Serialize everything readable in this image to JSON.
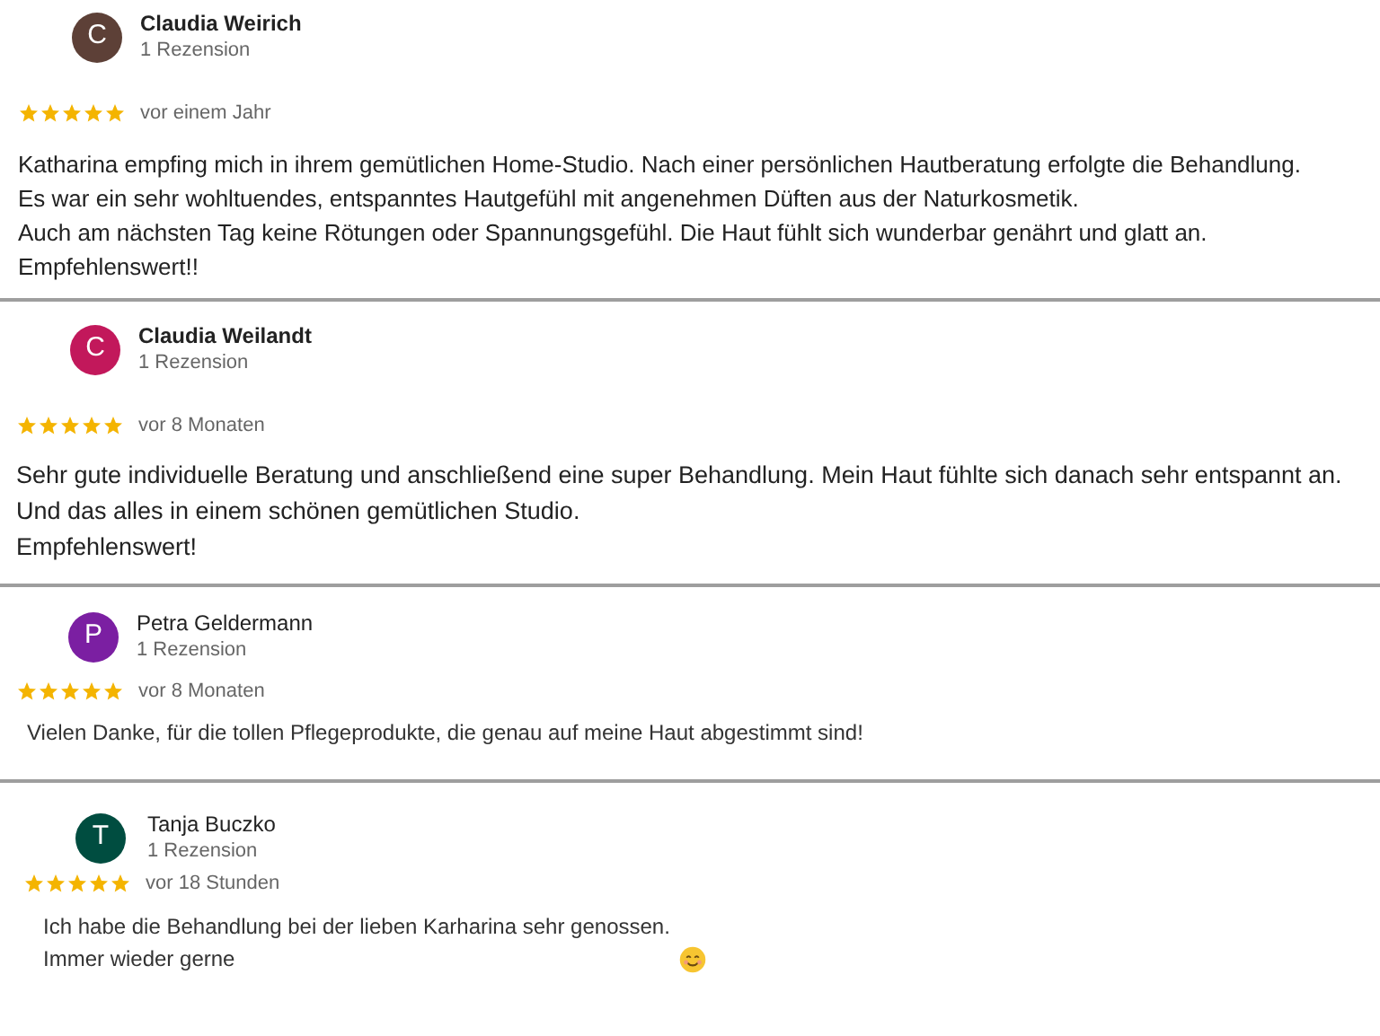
{
  "reviews": [
    {
      "initial": "C",
      "color": "#5d4037",
      "name": "Claudia Weirich",
      "count": "1 Rezension",
      "stars": 5,
      "time": "vor einem Jahr",
      "text": "Katharina empfing mich in ihrem gemütlichen Home-Studio. Nach einer persönlichen Hautberatung erfolgte die Behandlung.\nEs war ein sehr wohltuendes, entspanntes Hautgefühl mit angenehmen Düften aus der Naturkosmetik.\nAuch am nächsten Tag keine Rötungen oder Spannungsgefühl. Die Haut fühlt sich wunderbar genährt und glatt an.\nEmpfehlenswert!!",
      "emoji": false
    },
    {
      "initial": "C",
      "color": "#c2185b",
      "name": "Claudia Weilandt",
      "count": "1 Rezension",
      "stars": 5,
      "time": "vor 8 Monaten",
      "text": "Sehr gute individuelle Beratung und anschließend eine super Behandlung. Mein Haut fühlte sich danach sehr entspannt an.\nUnd das alles in einem schönen gemütlichen Studio.\nEmpfehlenswert!",
      "emoji": false
    },
    {
      "initial": "P",
      "color": "#7b1fa2",
      "name": "Petra Geldermann",
      "count": "1 Rezension",
      "stars": 5,
      "time": "vor 8 Monaten",
      "text": "Vielen Danke, für die tollen Pflegeprodukte, die genau auf meine Haut abgestimmt sind!",
      "emoji": false
    },
    {
      "initial": "T",
      "color": "#004d40",
      "name": "Tanja Buczko",
      "count": "1 Rezension",
      "stars": 5,
      "time": "vor 18 Stunden",
      "text": "Ich habe die Behandlung bei der lieben Karharina sehr genossen.\nImmer wieder gerne",
      "emoji": true
    }
  ]
}
